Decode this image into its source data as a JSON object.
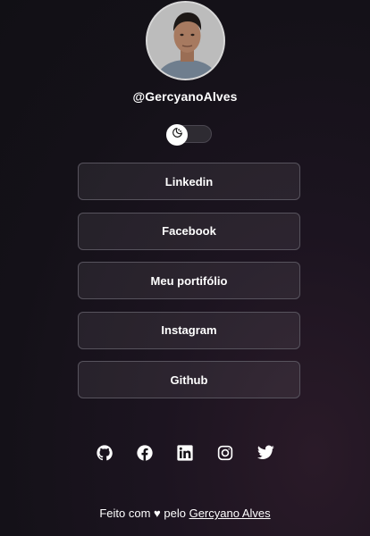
{
  "profile": {
    "username": "@GercyanoAlves"
  },
  "theme_toggle": {
    "icon": "moon-icon",
    "state": "off"
  },
  "links": [
    {
      "label": "Linkedin"
    },
    {
      "label": "Facebook"
    },
    {
      "label": "Meu portifólio"
    },
    {
      "label": "Instagram"
    },
    {
      "label": "Github"
    }
  ],
  "socials": [
    {
      "icon": "github-icon"
    },
    {
      "icon": "facebook-icon"
    },
    {
      "icon": "linkedin-icon"
    },
    {
      "icon": "instagram-icon"
    },
    {
      "icon": "twitter-icon"
    }
  ],
  "footer": {
    "prefix": "Feito com ♥ pelo ",
    "author": "Gercyano Alves"
  },
  "colors": {
    "background": "#151217",
    "button_border": "#57535d",
    "text": "#ffffff"
  }
}
